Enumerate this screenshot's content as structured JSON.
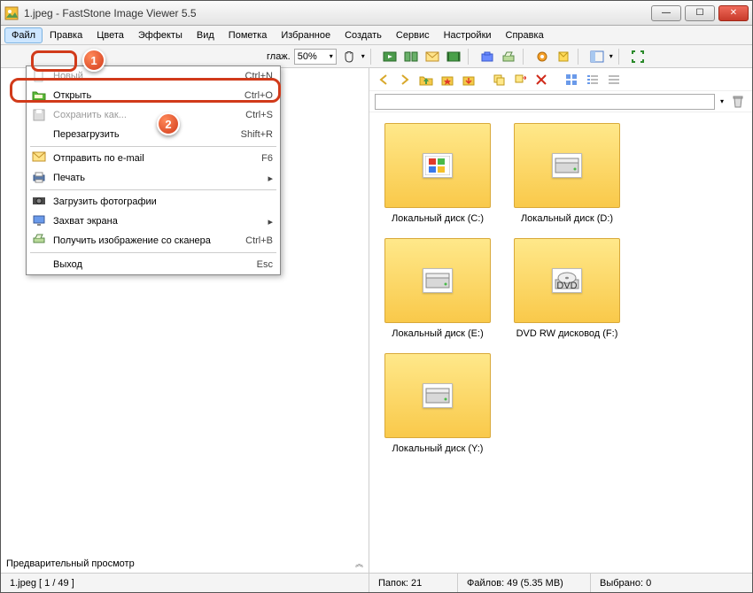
{
  "title": "1.jpeg - FastStone Image Viewer 5.5",
  "menubar": [
    "Файл",
    "Правка",
    "Цвета",
    "Эффекты",
    "Вид",
    "Пометка",
    "Избранное",
    "Создать",
    "Сервис",
    "Настройки",
    "Справка"
  ],
  "toolbar": {
    "smooth_label": "глаж.",
    "zoom": "50%"
  },
  "file_menu": {
    "new": {
      "label": "Новый",
      "shortcut": "Ctrl+N"
    },
    "open": {
      "label": "Открыть",
      "shortcut": "Ctrl+O"
    },
    "saveas": {
      "label": "Сохранить как...",
      "shortcut": "Ctrl+S"
    },
    "reload": {
      "label": "Перезагрузить",
      "shortcut": "Shift+R"
    },
    "email": {
      "label": "Отправить по e-mail",
      "shortcut": "F6"
    },
    "print": {
      "label": "Печать",
      "shortcut": "▸"
    },
    "upload": {
      "label": "Загрузить фотографии",
      "shortcut": ""
    },
    "capture": {
      "label": "Захват экрана",
      "shortcut": "▸"
    },
    "scan": {
      "label": "Получить изображение со сканера",
      "shortcut": "Ctrl+B"
    },
    "exit": {
      "label": "Выход",
      "shortcut": "Esc"
    }
  },
  "annotations": {
    "one": "1",
    "two": "2"
  },
  "drives": [
    {
      "label": "Локальный диск (C:)",
      "kind": "win"
    },
    {
      "label": "Локальный диск (D:)",
      "kind": "hdd"
    },
    {
      "label": "Локальный диск (E:)",
      "kind": "hdd"
    },
    {
      "label": "DVD RW дисковод (F:)",
      "kind": "dvd"
    },
    {
      "label": "Локальный диск (Y:)",
      "kind": "hdd"
    }
  ],
  "preview_label": "Предварительный просмотр",
  "status": {
    "file": "1.jpeg [ 1 / 49 ]",
    "folders": "Папок: 21",
    "files": "Файлов: 49 (5.35 MB)",
    "selected": "Выбрано: 0"
  }
}
